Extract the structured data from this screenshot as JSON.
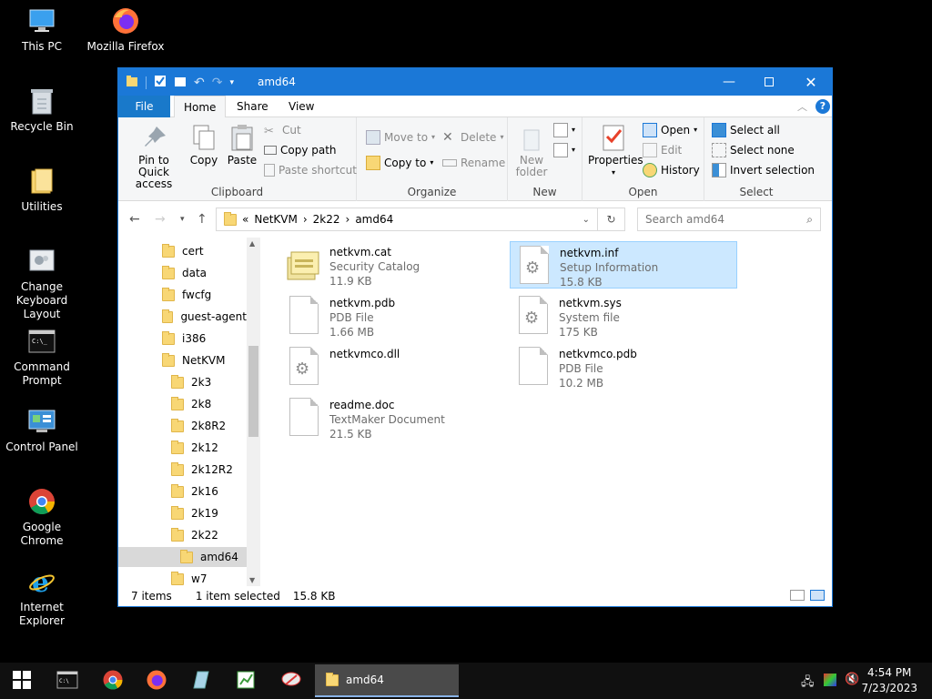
{
  "desktop": {
    "icons": [
      {
        "label": "This PC",
        "icon": "this-pc-icon"
      },
      {
        "label": "Mozilla Firefox",
        "icon": "firefox-icon"
      },
      {
        "label": "Recycle Bin",
        "icon": "recycle-bin-icon"
      },
      {
        "label": "Utilities",
        "icon": "folder-icon"
      },
      {
        "label": "Change Keyboard Layout",
        "icon": "keyboard-layout-icon"
      },
      {
        "label": "Command Prompt",
        "icon": "command-prompt-icon"
      },
      {
        "label": "Control Panel",
        "icon": "control-panel-icon"
      },
      {
        "label": "Google Chrome",
        "icon": "chrome-icon"
      },
      {
        "label": "Internet Explorer",
        "icon": "internet-explorer-icon"
      }
    ]
  },
  "window": {
    "title": "amd64",
    "tabs": {
      "file": "File",
      "home": "Home",
      "share": "Share",
      "view": "View"
    },
    "ribbon": {
      "clipboard": {
        "label": "Clipboard",
        "pin": "Pin to Quick access",
        "copy": "Copy",
        "paste": "Paste",
        "cut": "Cut",
        "copy_path": "Copy path",
        "paste_shortcut": "Paste shortcut"
      },
      "organize": {
        "label": "Organize",
        "move_to": "Move to",
        "copy_to": "Copy to",
        "delete": "Delete",
        "rename": "Rename"
      },
      "new": {
        "label": "New",
        "new_folder": "New folder"
      },
      "open": {
        "label": "Open",
        "properties": "Properties",
        "open": "Open",
        "edit": "Edit",
        "history": "History"
      },
      "select": {
        "label": "Select",
        "select_all": "Select all",
        "select_none": "Select none",
        "invert": "Invert selection"
      }
    },
    "address": {
      "overflow": "«",
      "crumbs": [
        "NetKVM",
        "2k22",
        "amd64"
      ],
      "separator": "›"
    },
    "search": {
      "placeholder": "Search amd64"
    },
    "nav": {
      "items": [
        {
          "label": "cert",
          "level": 0
        },
        {
          "label": "data",
          "level": 0
        },
        {
          "label": "fwcfg",
          "level": 0
        },
        {
          "label": "guest-agent",
          "level": 0
        },
        {
          "label": "i386",
          "level": 0
        },
        {
          "label": "NetKVM",
          "level": 0
        },
        {
          "label": "2k3",
          "level": 1
        },
        {
          "label": "2k8",
          "level": 1
        },
        {
          "label": "2k8R2",
          "level": 1
        },
        {
          "label": "2k12",
          "level": 1
        },
        {
          "label": "2k12R2",
          "level": 1
        },
        {
          "label": "2k16",
          "level": 1
        },
        {
          "label": "2k19",
          "level": 1
        },
        {
          "label": "2k22",
          "level": 1
        },
        {
          "label": "amd64",
          "level": 2,
          "selected": true
        },
        {
          "label": "w7",
          "level": 1
        }
      ]
    },
    "files": [
      {
        "name": "netkvm.cat",
        "type": "Security Catalog",
        "size": "11.9 KB",
        "icon": "security-catalog-icon"
      },
      {
        "name": "netkvm.inf",
        "type": "Setup Information",
        "size": "15.8 KB",
        "icon": "setup-information-icon",
        "selected": true
      },
      {
        "name": "netkvm.pdb",
        "type": "PDB File",
        "size": "1.66 MB",
        "icon": "document-icon"
      },
      {
        "name": "netkvm.sys",
        "type": "System file",
        "size": "175 KB",
        "icon": "system-file-icon"
      },
      {
        "name": "netkvmco.dll",
        "type": "",
        "size": "",
        "icon": "dll-icon"
      },
      {
        "name": "netkvmco.pdb",
        "type": "PDB File",
        "size": "10.2 MB",
        "icon": "document-icon"
      },
      {
        "name": "readme.doc",
        "type": "TextMaker Document",
        "size": "21.5 KB",
        "icon": "document-icon"
      }
    ],
    "status": {
      "count": "7 items",
      "selected": "1 item selected",
      "size": "15.8 KB"
    }
  },
  "taskbar": {
    "active_window": "amd64",
    "time": "4:54 PM",
    "date": "7/23/2023"
  },
  "colors": {
    "accent": "#1b78d7",
    "selection": "#cce8ff",
    "folder": "#f8d775"
  }
}
